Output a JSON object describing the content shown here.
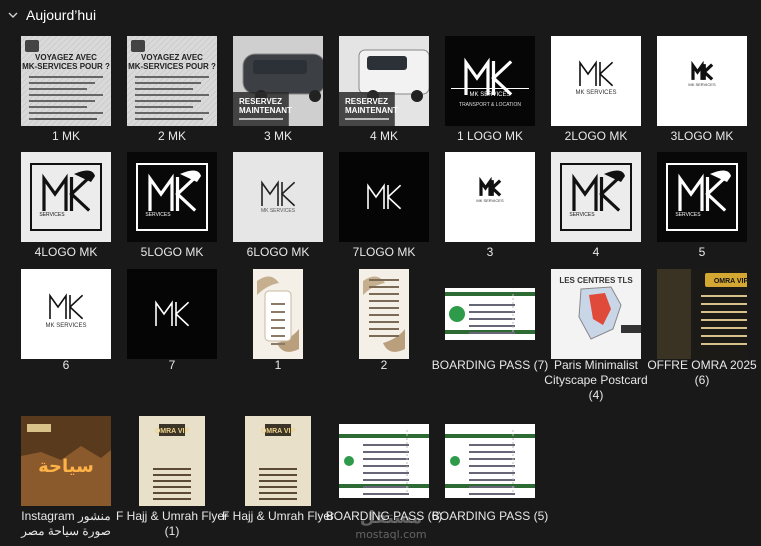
{
  "group": {
    "title": "Aujourd’hui",
    "icon": "chevron-down-icon"
  },
  "files": [
    {
      "name": "1 MK",
      "label": "1 MK",
      "thumb": "flyer-text",
      "heading": "VOYAGEZ AVEC MK-SERVICES POUR ?"
    },
    {
      "name": "2 MK",
      "label": "2 MK",
      "thumb": "flyer-text",
      "heading": "VOYAGEZ AVEC MK-SERVICES POUR ?"
    },
    {
      "name": "3 MK",
      "label": "3 MK",
      "thumb": "car-photo",
      "heading": "RESERVEZ MAINTENANT"
    },
    {
      "name": "4 MK",
      "label": "4 MK",
      "thumb": "van-photo",
      "heading": "RESERVEZ MAINTENANT"
    },
    {
      "name": "1 LOGO MK",
      "label": "1 LOGO MK",
      "thumb": "logo-black",
      "heading": "MK SERVICES"
    },
    {
      "name": "2LOGO MK",
      "label": "2LOGO MK",
      "thumb": "logo-white",
      "heading": "MK SERVICES"
    },
    {
      "name": "3LOGO MK",
      "label": "3LOGO MK",
      "thumb": "logo-white-small",
      "heading": "MK SERVICES"
    },
    {
      "name": "4LOGO MK",
      "label": "4LOGO MK",
      "thumb": "logo-frame-light",
      "heading": "SERVICES"
    },
    {
      "name": "5LOGO MK",
      "label": "5LOGO MK",
      "thumb": "logo-frame-dark",
      "heading": "SERVICES"
    },
    {
      "name": "6LOGO MK",
      "label": "6LOGO MK",
      "thumb": "logo-grey",
      "heading": "MK SERVICES"
    },
    {
      "name": "7LOGO MK",
      "label": "7LOGO MK",
      "thumb": "logo-black-thin",
      "heading": ""
    },
    {
      "name": "3",
      "label": "3",
      "thumb": "logo-white-small",
      "heading": "MK SERVICES"
    },
    {
      "name": "4",
      "label": "4",
      "thumb": "logo-frame-light",
      "heading": "SERVICES"
    },
    {
      "name": "5",
      "label": "5",
      "thumb": "logo-frame-dark",
      "heading": "SERVICES"
    },
    {
      "name": "6",
      "label": "6",
      "thumb": "logo-white",
      "heading": "MK SERVICES"
    },
    {
      "name": "7",
      "label": "7",
      "thumb": "logo-black-thin",
      "heading": ""
    },
    {
      "name": "1",
      "label": "1",
      "thumb": "invite",
      "heading": ""
    },
    {
      "name": "2",
      "label": "2",
      "thumb": "invite-text",
      "heading": ""
    },
    {
      "name": "BOARDING PASS (7)",
      "label": "BOARDING PASS (7)",
      "thumb": "boarding",
      "heading": ""
    },
    {
      "name": "Paris Minimalist Cityscape Postcard (4)",
      "label": "Paris Minimalist Cityscape Postcard (4)",
      "thumb": "map-card",
      "heading": "LES CENTRES TLS"
    },
    {
      "name": "OFFRE OMRA 2025 (6)",
      "label": "OFFRE OMRA 2025 (6)",
      "thumb": "omra-dark",
      "heading": "OMRA VIP"
    },
    {
      "name": "Instagram منشور صورة سياحة مصر",
      "label": "Instagram منشور صورة سياحة مصر",
      "thumb": "egypt",
      "heading": "سياحة"
    },
    {
      "name": "F Hajj & Umrah Flyer (1)",
      "label": "F Hajj & Umrah Flyer (1)",
      "thumb": "hajj",
      "heading": "OMRA VIP"
    },
    {
      "name": "F Hajj & Umrah Flyer",
      "label": "F Hajj & Umrah Flyer",
      "thumb": "hajj",
      "heading": "OMRA VIP"
    },
    {
      "name": "BOARDING PASS (6)",
      "label": "BOARDING PASS (6)",
      "thumb": "boarding-tall",
      "heading": ""
    },
    {
      "name": "BOARDING PASS (5)",
      "label": "BOARDING PASS (5)",
      "thumb": "boarding-tall",
      "heading": ""
    }
  ],
  "watermark": {
    "line1": "مستقل",
    "line2": "mostaql.com"
  }
}
